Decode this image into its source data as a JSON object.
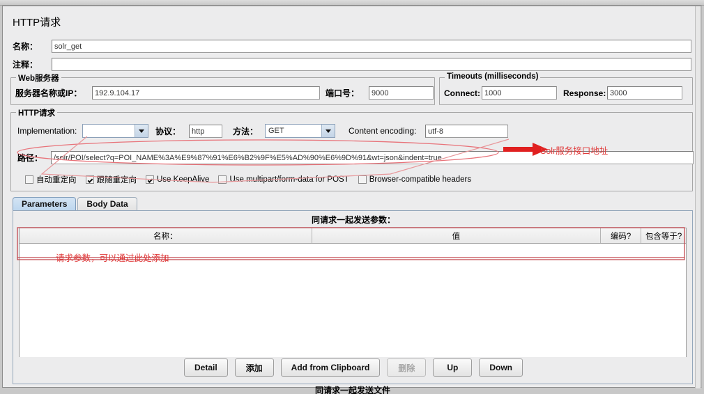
{
  "panel": {
    "title": "HTTP请求"
  },
  "fields": {
    "name_label": "名称：",
    "name_value": "solr_get",
    "comment_label": "注释：",
    "comment_value": ""
  },
  "webserver": {
    "caption": "Web服务器",
    "host_label": "服务器名称或IP：",
    "host_value": "192.9.104.17",
    "port_label": "端口号：",
    "port_value": "9000"
  },
  "timeouts": {
    "caption": "Timeouts (milliseconds)",
    "connect_label": "Connect:",
    "connect_value": "1000",
    "response_label": "Response:",
    "response_value": "3000"
  },
  "httprequest": {
    "caption": "HTTP请求",
    "implementation_label": "Implementation:",
    "implementation_value": "",
    "protocol_label": "协议：",
    "protocol_value": "http",
    "method_label": "方法：",
    "method_value": "GET",
    "encoding_label": "Content encoding:",
    "encoding_value": "utf-8",
    "path_label": "路径：",
    "path_value": "/solr/POI/select?q=POI_NAME%3A%E9%87%91%E6%B2%9F%E5%AD%90%E6%9D%91&wt=json&indent=true",
    "checkboxes": [
      {
        "label": "自动重定向",
        "checked": false
      },
      {
        "label": "跟随重定向",
        "checked": true
      },
      {
        "label": "Use KeepAlive",
        "checked": true
      },
      {
        "label": "Use multipart/form-data for POST",
        "checked": false
      },
      {
        "label": "Browser-compatible headers",
        "checked": false
      }
    ]
  },
  "tabs": [
    {
      "label": "Parameters",
      "active": true
    },
    {
      "label": "Body Data",
      "active": false
    }
  ],
  "parameters": {
    "send_with_request_title": "同请求一起发送参数：",
    "columns": [
      "名称：",
      "值",
      "编码?",
      "包含等于?"
    ],
    "rows": [],
    "buttons": [
      {
        "label": "Detail",
        "enabled": true
      },
      {
        "label": "添加",
        "enabled": true
      },
      {
        "label": "Add from Clipboard",
        "enabled": true
      },
      {
        "label": "删除",
        "enabled": false
      },
      {
        "label": "Up",
        "enabled": true
      },
      {
        "label": "Down",
        "enabled": true
      }
    ]
  },
  "bottom": {
    "clipped_title": "同请求一起发送文件"
  },
  "annotations": {
    "path_note": "Solr服务接口地址",
    "params_note": "请求参数，可以通过此处添加",
    "color": "#e03a3a"
  }
}
